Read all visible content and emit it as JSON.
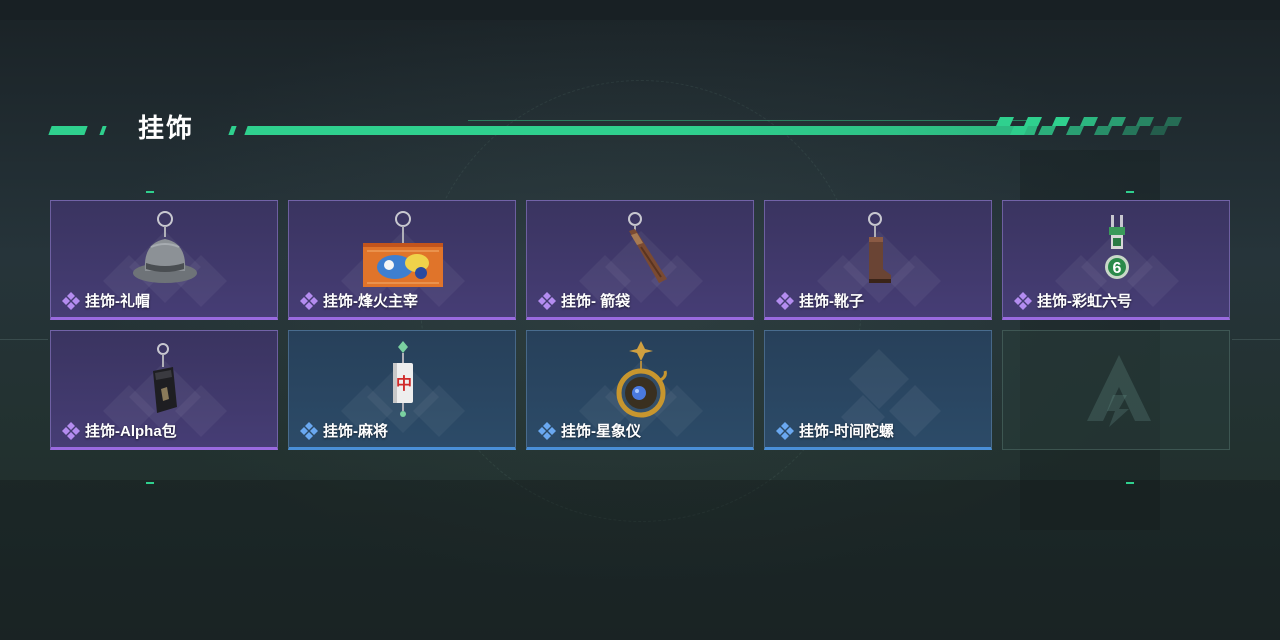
{
  "section": {
    "title": "挂饰"
  },
  "colors": {
    "accent_green": "#2fd08e",
    "rarity_purple": "#9a6ae0",
    "rarity_blue": "#4a8fd8"
  },
  "items": [
    {
      "name": "挂饰-礼帽",
      "rarity": "purple",
      "icon": "hat-charm-icon"
    },
    {
      "name": "挂饰-烽火主宰",
      "rarity": "purple",
      "icon": "banner-charm-icon"
    },
    {
      "name": "挂饰- 箭袋",
      "rarity": "purple",
      "icon": "quiver-charm-icon"
    },
    {
      "name": "挂饰-靴子",
      "rarity": "purple",
      "icon": "boot-charm-icon"
    },
    {
      "name": "挂饰-彩虹六号",
      "rarity": "purple",
      "icon": "rainbow-six-charm-icon"
    },
    {
      "name": "挂饰-Alpha包",
      "rarity": "purple",
      "icon": "alpha-pack-charm-icon"
    },
    {
      "name": "挂饰-麻将",
      "rarity": "blue",
      "icon": "mahjong-charm-icon"
    },
    {
      "name": "挂饰-星象仪",
      "rarity": "blue",
      "icon": "astrolabe-charm-icon"
    },
    {
      "name": "挂饰-时间陀螺",
      "rarity": "blue",
      "icon": "time-top-charm-icon"
    },
    {
      "name": "",
      "rarity": "empty",
      "icon": "empty-slot-logo-icon"
    }
  ]
}
